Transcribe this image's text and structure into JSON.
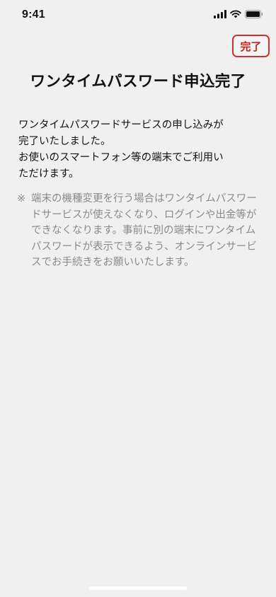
{
  "status_bar": {
    "time": "9:41",
    "icons": [
      "signal-icon",
      "wifi-icon",
      "battery-icon"
    ]
  },
  "header": {
    "done_label": "完了",
    "title": "ワンタイムパスワード申込完了"
  },
  "main": {
    "message_lines": [
      "ワンタイムパスワードサービスの申し込みが",
      "完了いたしました。",
      "お使いのスマートフォン等の端末でご利用い",
      "ただけます。"
    ],
    "note_mark": "※",
    "note_text": "端末の機種変更を行う場合はワンタイムパスワードサービスが使えなくなり、ログインや出金等ができなくなります。事前に別の端末にワンタイムパスワードが表示できるよう、オンラインサービスでお手続きをお願いいたします。"
  },
  "colors": {
    "background": "#f0f0f0",
    "accent": "#d23030",
    "note_text": "#8a8a8a"
  }
}
